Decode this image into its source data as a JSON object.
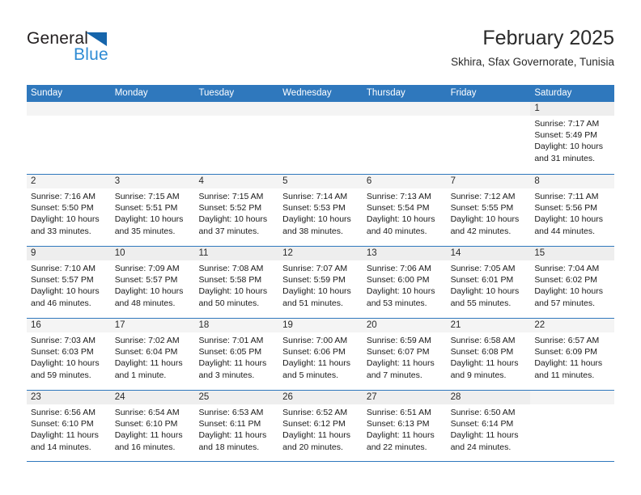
{
  "brand": {
    "name_part1": "General",
    "name_part2": "Blue",
    "triangle_color": "#1665ab",
    "blue_color": "#2e8bd4"
  },
  "header": {
    "title": "February 2025",
    "subtitle": "Skhira, Sfax Governorate, Tunisia"
  },
  "theme": {
    "header_blue": "#2f78bd",
    "band_gray": "#eeeeee",
    "grid_line": "#2f78bd"
  },
  "weekdays": [
    "Sunday",
    "Monday",
    "Tuesday",
    "Wednesday",
    "Thursday",
    "Friday",
    "Saturday"
  ],
  "weeks": [
    [
      {
        "day": "",
        "sunrise": "",
        "sunset": "",
        "daylight1": "",
        "daylight2": "",
        "empty": true
      },
      {
        "day": "",
        "sunrise": "",
        "sunset": "",
        "daylight1": "",
        "daylight2": "",
        "empty": true
      },
      {
        "day": "",
        "sunrise": "",
        "sunset": "",
        "daylight1": "",
        "daylight2": "",
        "empty": true
      },
      {
        "day": "",
        "sunrise": "",
        "sunset": "",
        "daylight1": "",
        "daylight2": "",
        "empty": true
      },
      {
        "day": "",
        "sunrise": "",
        "sunset": "",
        "daylight1": "",
        "daylight2": "",
        "empty": true
      },
      {
        "day": "",
        "sunrise": "",
        "sunset": "",
        "daylight1": "",
        "daylight2": "",
        "empty": true
      },
      {
        "day": "1",
        "sunrise": "Sunrise: 7:17 AM",
        "sunset": "Sunset: 5:49 PM",
        "daylight1": "Daylight: 10 hours",
        "daylight2": "and 31 minutes."
      }
    ],
    [
      {
        "day": "2",
        "sunrise": "Sunrise: 7:16 AM",
        "sunset": "Sunset: 5:50 PM",
        "daylight1": "Daylight: 10 hours",
        "daylight2": "and 33 minutes."
      },
      {
        "day": "3",
        "sunrise": "Sunrise: 7:15 AM",
        "sunset": "Sunset: 5:51 PM",
        "daylight1": "Daylight: 10 hours",
        "daylight2": "and 35 minutes."
      },
      {
        "day": "4",
        "sunrise": "Sunrise: 7:15 AM",
        "sunset": "Sunset: 5:52 PM",
        "daylight1": "Daylight: 10 hours",
        "daylight2": "and 37 minutes."
      },
      {
        "day": "5",
        "sunrise": "Sunrise: 7:14 AM",
        "sunset": "Sunset: 5:53 PM",
        "daylight1": "Daylight: 10 hours",
        "daylight2": "and 38 minutes."
      },
      {
        "day": "6",
        "sunrise": "Sunrise: 7:13 AM",
        "sunset": "Sunset: 5:54 PM",
        "daylight1": "Daylight: 10 hours",
        "daylight2": "and 40 minutes."
      },
      {
        "day": "7",
        "sunrise": "Sunrise: 7:12 AM",
        "sunset": "Sunset: 5:55 PM",
        "daylight1": "Daylight: 10 hours",
        "daylight2": "and 42 minutes."
      },
      {
        "day": "8",
        "sunrise": "Sunrise: 7:11 AM",
        "sunset": "Sunset: 5:56 PM",
        "daylight1": "Daylight: 10 hours",
        "daylight2": "and 44 minutes."
      }
    ],
    [
      {
        "day": "9",
        "sunrise": "Sunrise: 7:10 AM",
        "sunset": "Sunset: 5:57 PM",
        "daylight1": "Daylight: 10 hours",
        "daylight2": "and 46 minutes."
      },
      {
        "day": "10",
        "sunrise": "Sunrise: 7:09 AM",
        "sunset": "Sunset: 5:57 PM",
        "daylight1": "Daylight: 10 hours",
        "daylight2": "and 48 minutes."
      },
      {
        "day": "11",
        "sunrise": "Sunrise: 7:08 AM",
        "sunset": "Sunset: 5:58 PM",
        "daylight1": "Daylight: 10 hours",
        "daylight2": "and 50 minutes."
      },
      {
        "day": "12",
        "sunrise": "Sunrise: 7:07 AM",
        "sunset": "Sunset: 5:59 PM",
        "daylight1": "Daylight: 10 hours",
        "daylight2": "and 51 minutes."
      },
      {
        "day": "13",
        "sunrise": "Sunrise: 7:06 AM",
        "sunset": "Sunset: 6:00 PM",
        "daylight1": "Daylight: 10 hours",
        "daylight2": "and 53 minutes."
      },
      {
        "day": "14",
        "sunrise": "Sunrise: 7:05 AM",
        "sunset": "Sunset: 6:01 PM",
        "daylight1": "Daylight: 10 hours",
        "daylight2": "and 55 minutes."
      },
      {
        "day": "15",
        "sunrise": "Sunrise: 7:04 AM",
        "sunset": "Sunset: 6:02 PM",
        "daylight1": "Daylight: 10 hours",
        "daylight2": "and 57 minutes."
      }
    ],
    [
      {
        "day": "16",
        "sunrise": "Sunrise: 7:03 AM",
        "sunset": "Sunset: 6:03 PM",
        "daylight1": "Daylight: 10 hours",
        "daylight2": "and 59 minutes."
      },
      {
        "day": "17",
        "sunrise": "Sunrise: 7:02 AM",
        "sunset": "Sunset: 6:04 PM",
        "daylight1": "Daylight: 11 hours",
        "daylight2": "and 1 minute."
      },
      {
        "day": "18",
        "sunrise": "Sunrise: 7:01 AM",
        "sunset": "Sunset: 6:05 PM",
        "daylight1": "Daylight: 11 hours",
        "daylight2": "and 3 minutes."
      },
      {
        "day": "19",
        "sunrise": "Sunrise: 7:00 AM",
        "sunset": "Sunset: 6:06 PM",
        "daylight1": "Daylight: 11 hours",
        "daylight2": "and 5 minutes."
      },
      {
        "day": "20",
        "sunrise": "Sunrise: 6:59 AM",
        "sunset": "Sunset: 6:07 PM",
        "daylight1": "Daylight: 11 hours",
        "daylight2": "and 7 minutes."
      },
      {
        "day": "21",
        "sunrise": "Sunrise: 6:58 AM",
        "sunset": "Sunset: 6:08 PM",
        "daylight1": "Daylight: 11 hours",
        "daylight2": "and 9 minutes."
      },
      {
        "day": "22",
        "sunrise": "Sunrise: 6:57 AM",
        "sunset": "Sunset: 6:09 PM",
        "daylight1": "Daylight: 11 hours",
        "daylight2": "and 11 minutes."
      }
    ],
    [
      {
        "day": "23",
        "sunrise": "Sunrise: 6:56 AM",
        "sunset": "Sunset: 6:10 PM",
        "daylight1": "Daylight: 11 hours",
        "daylight2": "and 14 minutes."
      },
      {
        "day": "24",
        "sunrise": "Sunrise: 6:54 AM",
        "sunset": "Sunset: 6:10 PM",
        "daylight1": "Daylight: 11 hours",
        "daylight2": "and 16 minutes."
      },
      {
        "day": "25",
        "sunrise": "Sunrise: 6:53 AM",
        "sunset": "Sunset: 6:11 PM",
        "daylight1": "Daylight: 11 hours",
        "daylight2": "and 18 minutes."
      },
      {
        "day": "26",
        "sunrise": "Sunrise: 6:52 AM",
        "sunset": "Sunset: 6:12 PM",
        "daylight1": "Daylight: 11 hours",
        "daylight2": "and 20 minutes."
      },
      {
        "day": "27",
        "sunrise": "Sunrise: 6:51 AM",
        "sunset": "Sunset: 6:13 PM",
        "daylight1": "Daylight: 11 hours",
        "daylight2": "and 22 minutes."
      },
      {
        "day": "28",
        "sunrise": "Sunrise: 6:50 AM",
        "sunset": "Sunset: 6:14 PM",
        "daylight1": "Daylight: 11 hours",
        "daylight2": "and 24 minutes."
      },
      {
        "day": "",
        "sunrise": "",
        "sunset": "",
        "daylight1": "",
        "daylight2": "",
        "empty": true
      }
    ]
  ]
}
